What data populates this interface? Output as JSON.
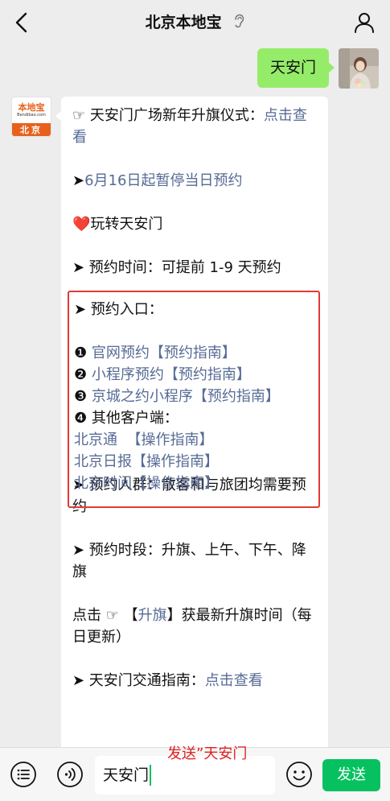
{
  "header": {
    "title": "北京本地宝"
  },
  "chat": {
    "outgoing": {
      "text": "天安门"
    },
    "bot_avatar": {
      "logo": "本地宝",
      "site": "Bendibao.com",
      "city": "北京"
    },
    "reply": {
      "line1_prefix": "☞ 天安门广场新年升旗仪式：",
      "line1_link": "点击查看",
      "line2_arrow": "➤",
      "line2_link": "6月16日起暂停当日预约",
      "line3": "❤️玩转天安门",
      "line4": "➤ 预约时间：可提前 1-9 天预约",
      "entry_title": "➤ 预约入口：",
      "entries": [
        {
          "num": "❶ ",
          "name": "官网预约",
          "guide": "【预约指南】"
        },
        {
          "num": "❷ ",
          "name": "小程序预约",
          "guide": "【预约指南】"
        },
        {
          "num": "❸ ",
          "name": "京城之约小程序",
          "guide": "【预约指南】"
        }
      ],
      "other_clients_title": "❹ 其他客户端：",
      "clients": [
        {
          "name": "北京通",
          "gap": "  ",
          "guide": "【操作指南】"
        },
        {
          "name": "北京日报",
          "gap": "",
          "guide": "【操作指南】"
        },
        {
          "name": "北京时间",
          "gap": "",
          "guide": "【操作指南】"
        }
      ],
      "crowd": "➤ 预约人群：散客和与旅团均需要预约",
      "periods": "➤ 预约时段：升旗、上午、下午、降旗",
      "flag_prefix": "点击 ☞ 【",
      "flag_link": "升旗",
      "flag_suffix": "】获最新升旗时间（每日更新）",
      "traffic_prefix": "➤ 天安门交通指南：",
      "traffic_link": "点击查看"
    }
  },
  "input_bar": {
    "value": "天安门",
    "send_label": "发送"
  },
  "annotation": "发送”天安门",
  "colors": {
    "link": "#576b95",
    "accent": "#07c160",
    "bubble_me": "#95ec69",
    "highlight": "#e53935"
  }
}
